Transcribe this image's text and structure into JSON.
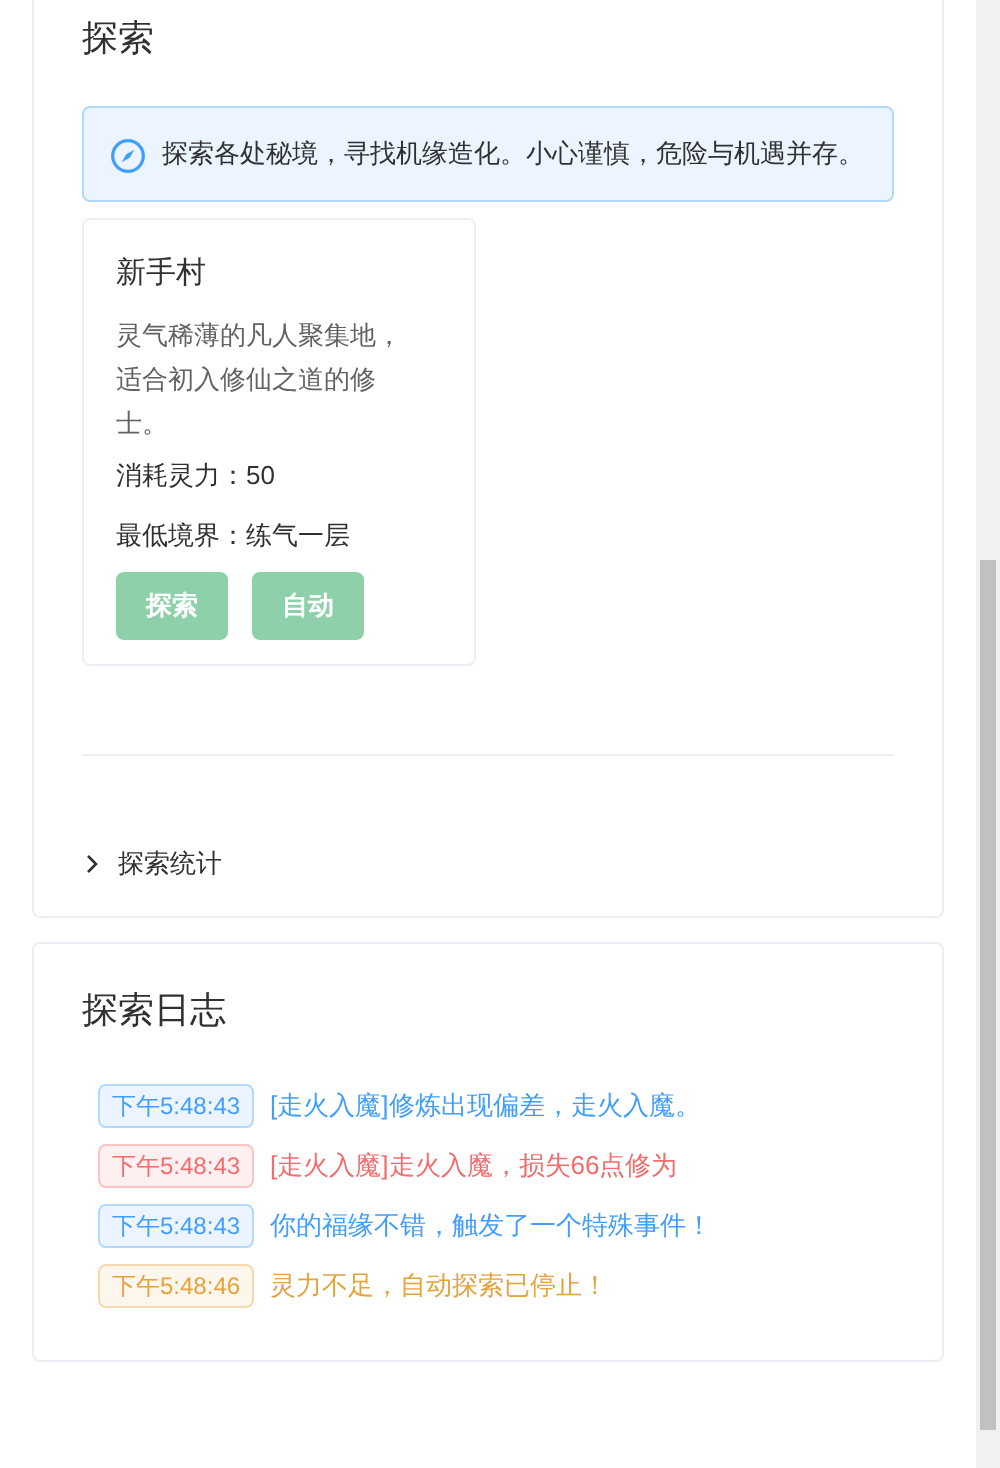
{
  "explore": {
    "title": "探索",
    "notice": "探索各处秘境，寻找机缘造化。小心谨慎，危险与机遇并存。",
    "areas": [
      {
        "name": "新手村",
        "description": "灵气稀薄的凡人聚集地，适合初入修仙之道的修士。",
        "cost": "消耗灵力：50",
        "requirement": "最低境界：练气一层",
        "buttons": [
          {
            "label": "探索",
            "disabled": true
          },
          {
            "label": "自动",
            "disabled": true
          }
        ]
      }
    ],
    "stats": {
      "label": "探索统计",
      "expanded": false
    }
  },
  "log": {
    "title": "探索日志",
    "entries": [
      {
        "time": "下午5:48:43",
        "message": "[走火入魔]修炼出现偏差，走火入魔。",
        "kind": "info"
      },
      {
        "time": "下午5:48:43",
        "message": "[走火入魔]走火入魔，损失66点修为",
        "kind": "danger"
      },
      {
        "time": "下午5:48:43",
        "message": "你的福缘不错，触发了一个特殊事件！",
        "kind": "info"
      },
      {
        "time": "下午5:48:46",
        "message": "灵力不足，自动探索已停止！",
        "kind": "warning"
      }
    ]
  }
}
